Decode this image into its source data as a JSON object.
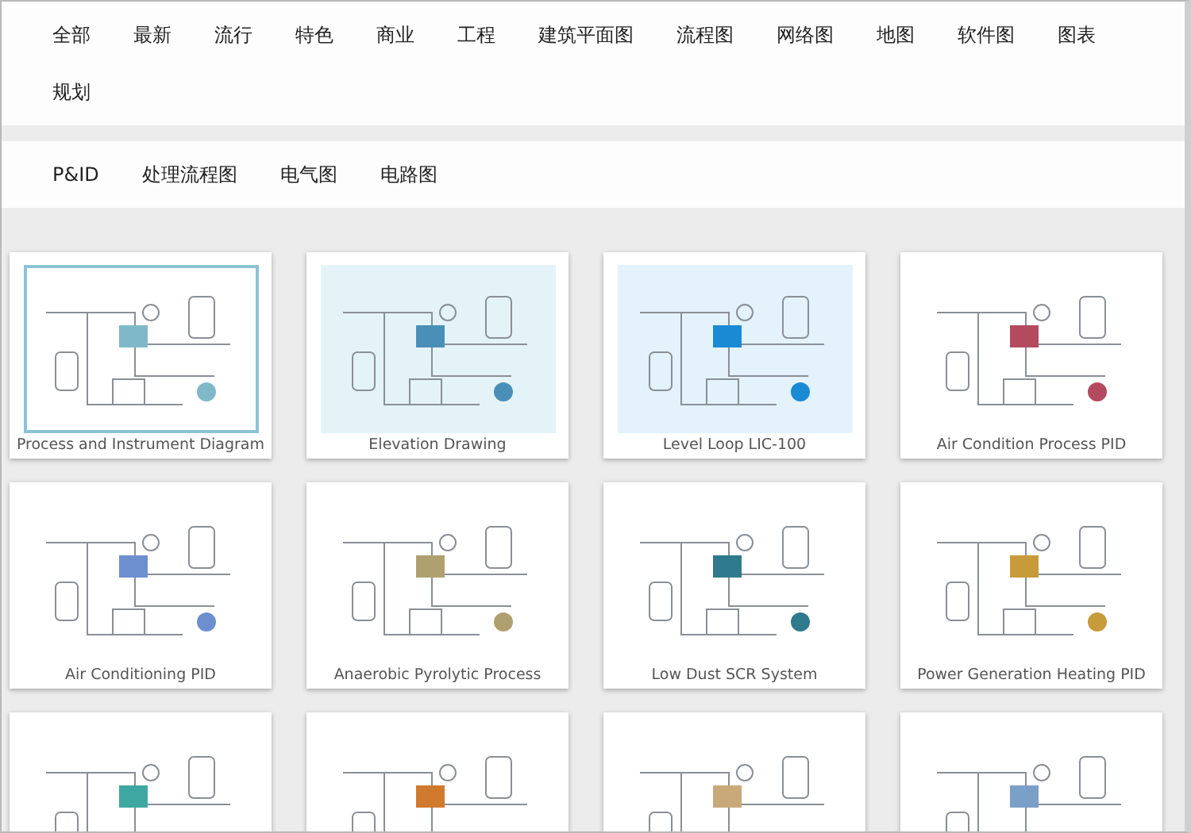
{
  "categories": [
    {
      "label": "全部",
      "selected": false
    },
    {
      "label": "最新",
      "selected": false
    },
    {
      "label": "流行",
      "selected": false
    },
    {
      "label": "特色",
      "selected": false
    },
    {
      "label": "商业",
      "selected": false
    },
    {
      "label": "工程",
      "selected": false
    },
    {
      "label": "建筑平面图",
      "selected": false
    },
    {
      "label": "流程图",
      "selected": false
    },
    {
      "label": "网络图",
      "selected": false
    },
    {
      "label": "地图",
      "selected": false
    },
    {
      "label": "软件图",
      "selected": false
    },
    {
      "label": "图表",
      "selected": false
    },
    {
      "label": "规划",
      "selected": false
    }
  ],
  "subcategories": [
    {
      "label": "P&ID",
      "selected": false
    },
    {
      "label": "处理流程图",
      "selected": false
    },
    {
      "label": "电气图",
      "selected": false
    },
    {
      "label": "电路图",
      "selected": false
    }
  ],
  "templates": [
    {
      "kind": "diagram",
      "title": "Process and Instrument Diagram"
    },
    {
      "kind": "diagram",
      "title": "Elevation Drawing"
    },
    {
      "kind": "diagram",
      "title": "Level Loop LIC-100"
    },
    {
      "kind": "diagram",
      "title": "Air Condition Process PID"
    },
    {
      "kind": "diagram",
      "title": "Air Conditioning PID"
    },
    {
      "kind": "diagram",
      "title": "Anaerobic Pyrolytic Process"
    },
    {
      "kind": "diagram",
      "title": "Low Dust SCR System"
    },
    {
      "kind": "diagram",
      "title": "Power Generation Heating PID"
    },
    {
      "kind": "diagram"
    },
    {
      "kind": "diagram"
    },
    {
      "kind": "diagram"
    },
    {
      "kind": "diagram"
    }
  ]
}
